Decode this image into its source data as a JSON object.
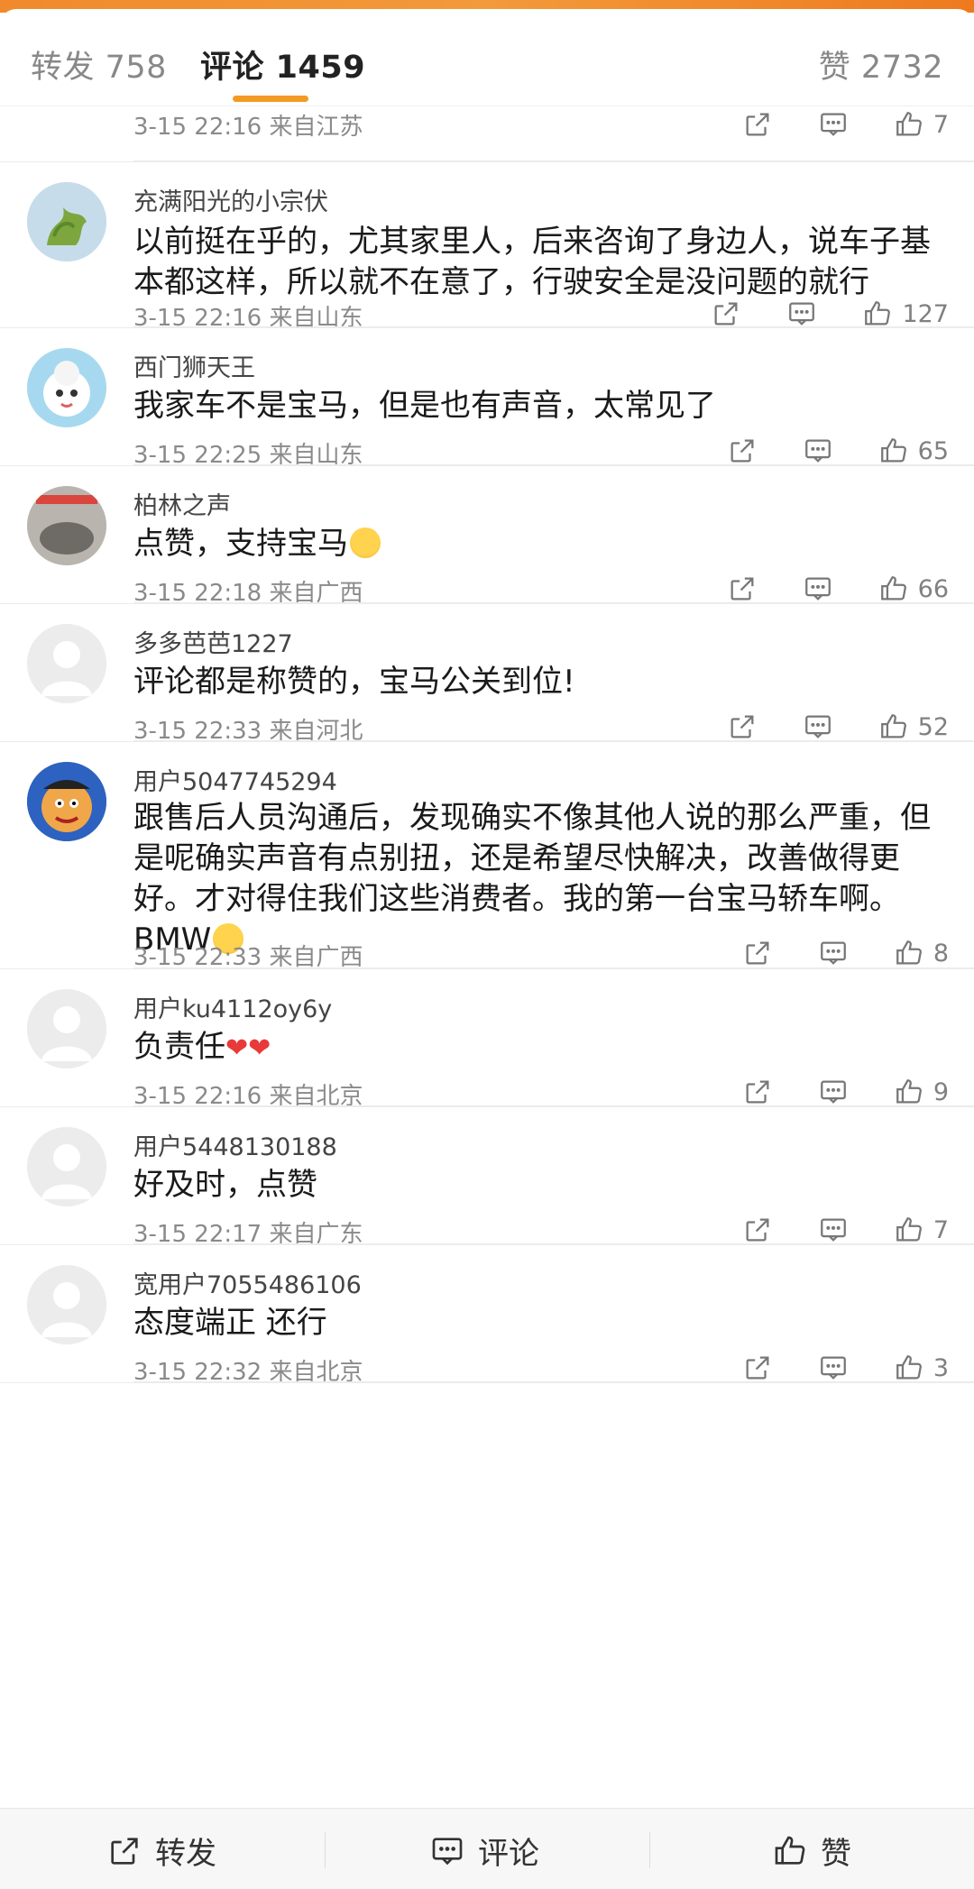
{
  "tabs": {
    "repost": "转发 758",
    "comment": "评论 1459",
    "like": "赞 2732"
  },
  "partial_top": {
    "meta": "3-15 22:16 来自江苏",
    "likes": "7"
  },
  "comments": [
    {
      "name": "充满阳光的小宗伏",
      "text": "以前挺在乎的，尤其家里人，后来咨询了身边人，说车子基本都这样，所以就不在意了，行驶安全是没问题的就行",
      "meta": "3-15 22:16 来自山东",
      "likes": "127"
    },
    {
      "name": "西门狮天王",
      "text": "我家车不是宝马，但是也有声音，太常见了",
      "meta": "3-15 22:25 来自山东",
      "likes": "65"
    },
    {
      "name": "柏林之声",
      "text": "点赞，支持宝马",
      "meta": "3-15 22:18 来自广西",
      "likes": "66"
    },
    {
      "name": "多多芭芭1227",
      "text": "评论都是称赞的，宝马公关到位!",
      "meta": "3-15 22:33 来自河北",
      "likes": "52"
    },
    {
      "name": "用户5047745294",
      "text": "跟售后人员沟通后，发现确实不像其他人说的那么严重，但是呢确实声音有点别扭，还是希望尽快解决，改善做得更好。才对得住我们这些消费者。我的第一台宝马轿车啊。BMW",
      "meta": "3-15 22:33 来自广西",
      "likes": "8"
    },
    {
      "name": "用户ku4112oy6y",
      "text": "负责任",
      "meta": "3-15 22:16 来自北京",
      "likes": "9"
    },
    {
      "name": "用户5448130188",
      "text": "好及时，点赞",
      "meta": "3-15 22:17 来自广东",
      "likes": "7"
    },
    {
      "name": "宽用户7055486106",
      "text": "态度端正 还行",
      "meta": "3-15 22:32 来自北京",
      "likes": "3"
    }
  ],
  "bottom": {
    "repost": "转发",
    "comment": "评论",
    "like": "赞"
  },
  "icons": [
    "share-icon",
    "comment-icon",
    "like-icon",
    "compose-icon"
  ],
  "colors": {
    "accent": "#f39a22",
    "meta": "#8a8a8a",
    "heart": "#e83a3a"
  }
}
